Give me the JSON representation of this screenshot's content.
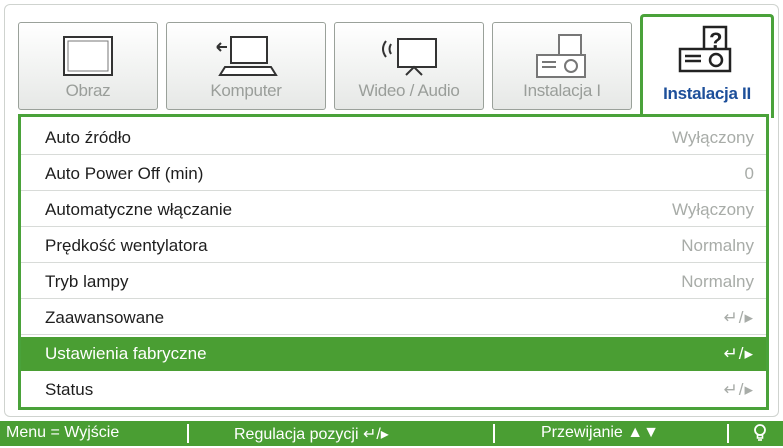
{
  "tabs": [
    {
      "label": "Obraz",
      "icon": "display-icon",
      "active": false
    },
    {
      "label": "Komputer",
      "icon": "computer-icon",
      "active": false
    },
    {
      "label": "Wideo / Audio",
      "icon": "video-audio-icon",
      "active": false
    },
    {
      "label": "Instalacja I",
      "icon": "projector-icon",
      "active": false
    },
    {
      "label": "Instalacja II",
      "icon": "projector-help-icon",
      "active": true
    }
  ],
  "menu": [
    {
      "label": "Auto źródło",
      "value": "Wyłączony"
    },
    {
      "label": "Auto Power Off (min)",
      "value": "0"
    },
    {
      "label": "Automatyczne włączanie",
      "value": "Wyłączony"
    },
    {
      "label": "Prędkość wentylatora",
      "value": "Normalny"
    },
    {
      "label": "Tryb lampy",
      "value": "Normalny"
    },
    {
      "label": "Zaawansowane",
      "value": "↵/▸"
    },
    {
      "label": "Ustawienia fabryczne",
      "value": "↵/▸",
      "selected": true
    },
    {
      "label": "Status",
      "value": "↵/▸"
    }
  ],
  "statusbar": {
    "exit": "Menu = Wyjście",
    "adjust": "Regulacja pozycji ↵/▸",
    "scroll": "Przewijanie ▲▼"
  },
  "colors": {
    "accent": "#4a9e33",
    "active_text": "#1d4f9a"
  }
}
